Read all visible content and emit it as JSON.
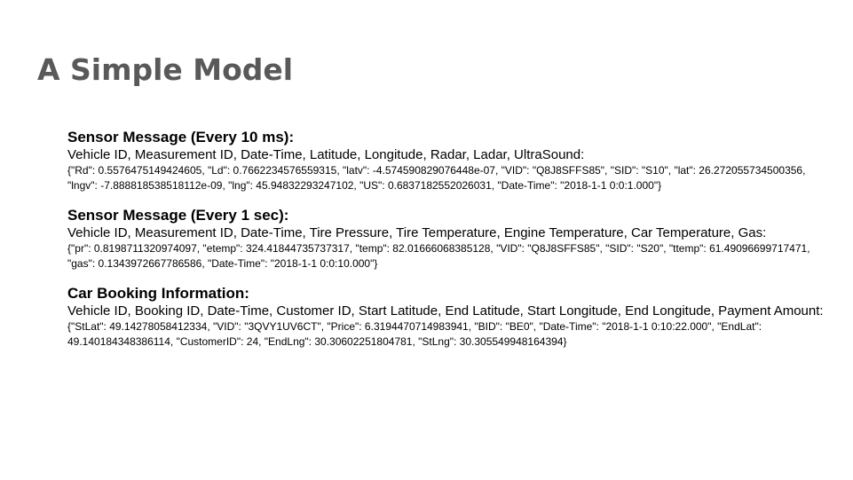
{
  "slide": {
    "title": "A Simple Model"
  },
  "sections": [
    {
      "title": "Sensor Message (Every 10 ms):",
      "fields": "Vehicle ID, Measurement ID, Date-Time, Latitude, Longitude, Radar, Ladar, UltraSound:",
      "example": "{\"Rd\": 0.5576475149424605, \"Ld\": 0.7662234576559315, \"latv\": -4.574590829076448e-07, \"VID\": \"Q8J8SFFS85\", \"SID\": \"S10\", \"lat\": 26.272055734500356, \"lngv\": -7.888818538518112e-09, \"lng\": 45.94832293247102, \"US\": 0.6837182552026031, \"Date-Time\": \"2018-1-1 0:0:1.000\"}"
    },
    {
      "title": "Sensor Message (Every 1 sec):",
      "fields": "Vehicle ID, Measurement ID, Date-Time, Tire Pressure, Tire Temperature, Engine Temperature, Car Temperature, Gas:",
      "example": "{\"pr\": 0.8198711320974097, \"etemp\": 324.41844735737317, \"temp\": 82.01666068385128, \"VID\": \"Q8J8SFFS85\", \"SID\": \"S20\", \"ttemp\": 61.49096699717471, \"gas\": 0.1343972667786586, \"Date-Time\": \"2018-1-1 0:0:10.000\"}"
    },
    {
      "title": "Car Booking Information:",
      "fields": "Vehicle ID, Booking ID, Date-Time, Customer ID, Start Latitude, End Latitude, Start Longitude, End Longitude, Payment Amount:",
      "example": "{\"StLat\": 49.14278058412334, \"VID\": \"3QVY1UV6CT\", \"Price\": 6.3194470714983941, \"BID\": \"BE0\", \"Date-Time\": \"2018-1-1 0:10:22.000\", \"EndLat\": 49.140184348386114, \"CustomerID\": 24, \"EndLng\": 30.30602251804781, \"StLng\": 30.305549948164394}"
    }
  ]
}
